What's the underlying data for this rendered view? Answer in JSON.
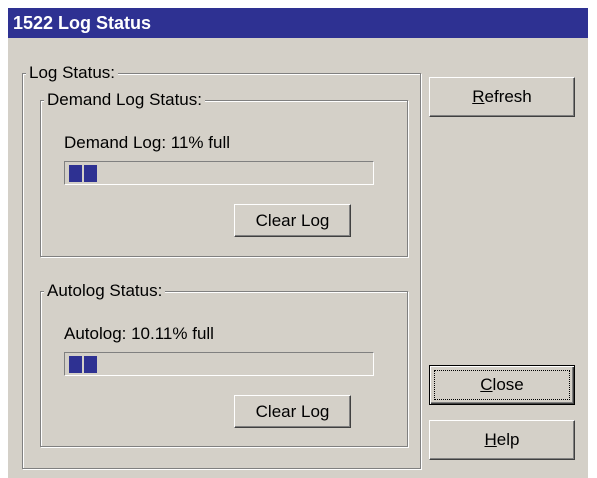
{
  "window": {
    "title": "1522 Log Status"
  },
  "log_status": {
    "label": "Log Status:",
    "demand": {
      "group_label": "Demand Log Status:",
      "status_text": "Demand Log: 11% full",
      "percent_full": 11,
      "clear_label": "Clear Log"
    },
    "autolog": {
      "group_label": "Autolog Status:",
      "status_text": "Autolog: 10.11% full",
      "percent_full": 10.11,
      "clear_label": "Clear Log"
    }
  },
  "buttons": {
    "refresh": {
      "mnemonic": "R",
      "rest": "efresh"
    },
    "close": {
      "mnemonic": "C",
      "rest": "lose"
    },
    "help": {
      "mnemonic": "H",
      "rest": "elp"
    }
  },
  "colors": {
    "title_bar": "#2e3192",
    "progress_fill": "#2e3192",
    "dialog_face": "#d4d0c8"
  }
}
